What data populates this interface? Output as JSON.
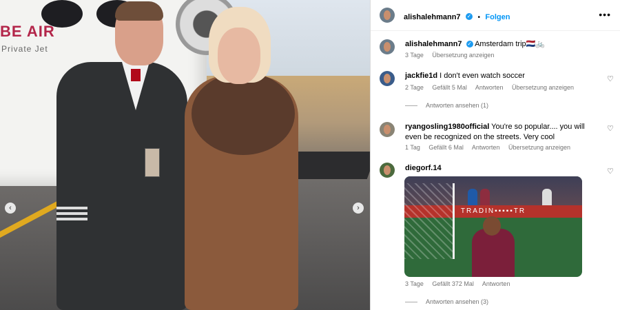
{
  "media": {
    "brand_text": "BE AIR",
    "brand_sub": "Private Jet",
    "prev_button": "‹",
    "next_button": "›"
  },
  "header": {
    "username": "alishalehmann7",
    "verified_mark": "✓",
    "separator": "•",
    "follow_label": "Folgen",
    "more_label": "•••"
  },
  "caption": {
    "username": "alishalehmann7",
    "text": "Amsterdam trip🇳🇱🚲",
    "time": "3 Tage",
    "translate": "Übersetzung anzeigen"
  },
  "comments": [
    {
      "username": "jackfie1d",
      "text": "I don't even watch soccer",
      "time": "2 Tage",
      "likes": "Gefällt 5 Mal",
      "reply": "Antworten",
      "translate": "Übersetzung anzeigen",
      "view_replies": "Antworten ansehen (1)"
    },
    {
      "username": "ryangosling1980official",
      "text": "You're so popular.... you will even be recognized on the streets. Very cool",
      "time": "1 Tag",
      "likes": "Gefällt 6 Mal",
      "reply": "Antworten",
      "translate": "Übersetzung anzeigen"
    },
    {
      "username": "diegorf.14",
      "time": "3 Tage",
      "likes": "Gefällt 372 Mal",
      "reply": "Antworten",
      "view_replies": "Antworten ansehen (3)",
      "image_board": "TRADIN▪▪▪▪▪TR"
    }
  ],
  "icons": {
    "heart": "♡"
  },
  "colors": {
    "follow_blue": "#0095f6",
    "verified_blue": "#1d9bf0",
    "brand_red": "#b3264a"
  }
}
